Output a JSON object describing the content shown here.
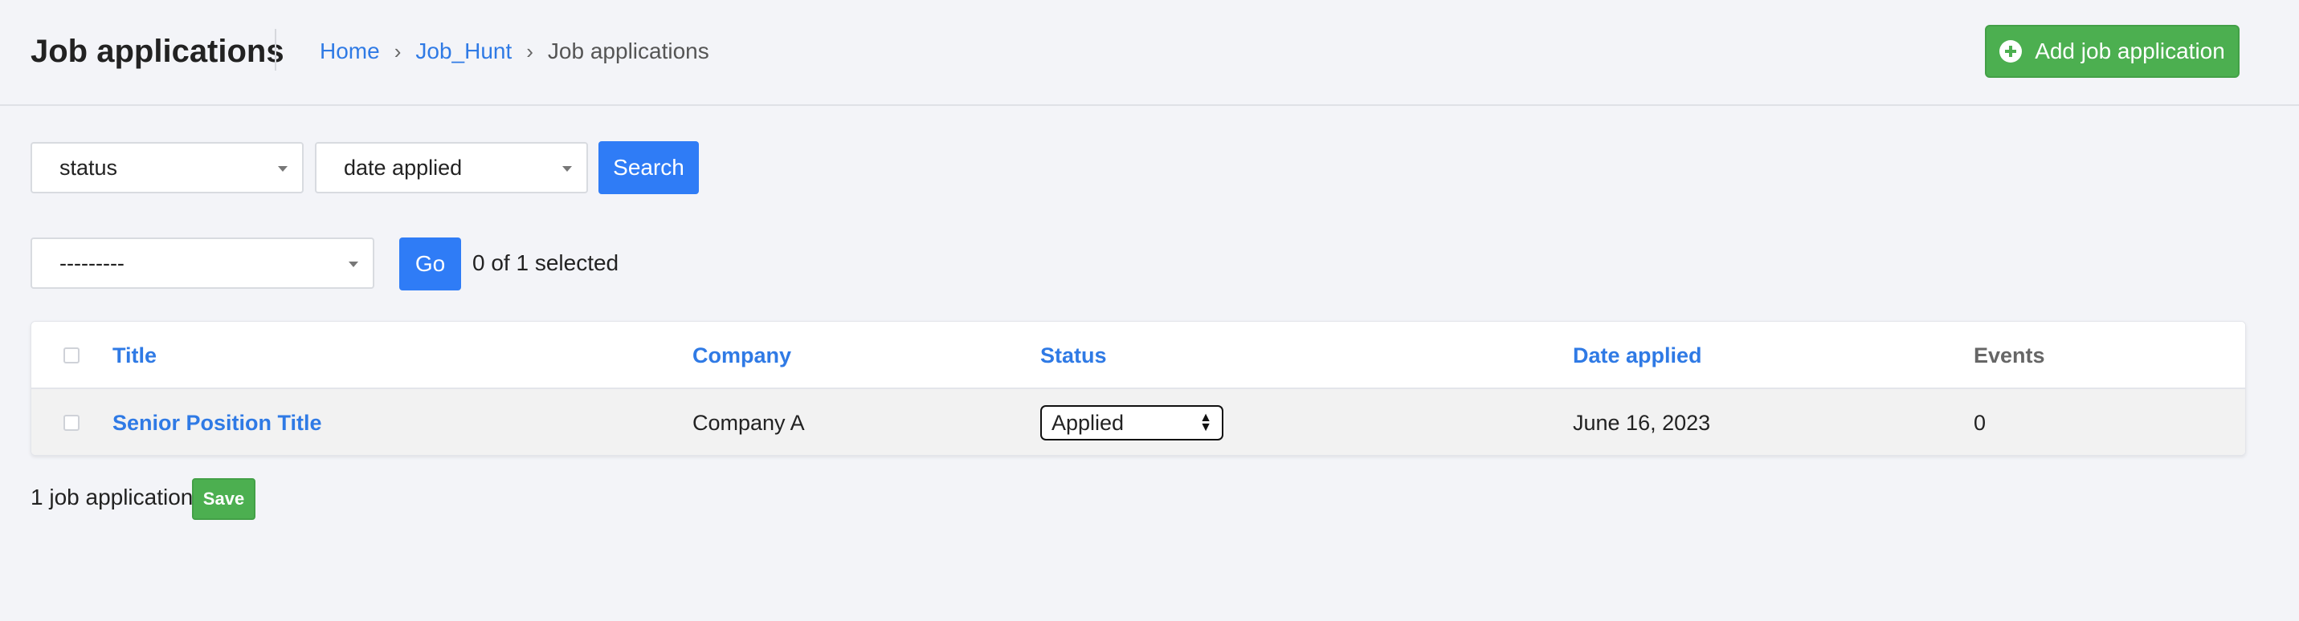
{
  "header": {
    "title": "Job applications",
    "breadcrumb": [
      {
        "label": "Home"
      },
      {
        "label": "Job_Hunt"
      },
      {
        "label": "Job applications"
      }
    ],
    "breadcrumb_separator": "›",
    "add_button_label": "Add job application"
  },
  "filters": {
    "status_value": "status",
    "date_value": "date applied",
    "search_label": "Search"
  },
  "actions": {
    "action_select_value": "---------",
    "go_label": "Go",
    "selected_text": "0 of 1 selected"
  },
  "table": {
    "columns": [
      "Title",
      "Company",
      "Status",
      "Date applied",
      "Events"
    ],
    "rows": [
      {
        "title": "Senior Position Title",
        "company": "Company A",
        "status": "Applied",
        "date_applied": "June 16, 2023",
        "events": "0"
      }
    ]
  },
  "footer": {
    "count_text": "1 job application",
    "save_label": "Save"
  },
  "colors": {
    "accent_blue": "#2f7cf6",
    "link_blue": "#2f7ae5",
    "success_green": "#4caf50",
    "background": "#f3f4f8"
  },
  "icons": {
    "add": "plus-circle-icon",
    "dropdown": "chevron-down-icon"
  }
}
